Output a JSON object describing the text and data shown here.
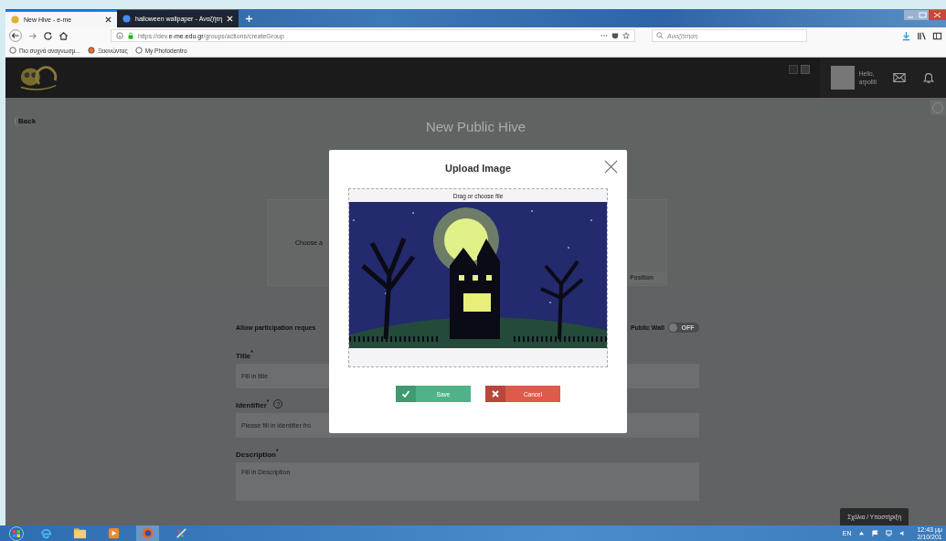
{
  "browser": {
    "tabs": [
      {
        "title": "New Hive - e-me",
        "selected": true
      },
      {
        "title": "halloween wallpaper - Αναζήτη",
        "selected": false
      }
    ],
    "url": "https://dev.**e-me.edu.gr**/groups/actions/createGroup",
    "search_placeholder": "Αναζήτηση",
    "bookmarks": [
      "Πιο συχνά αναγνωσμ...",
      "Ξεκινώντας",
      "My Photodentro"
    ]
  },
  "header": {
    "greeting": "Hello,",
    "username": "arpoliti"
  },
  "page": {
    "back": "Back",
    "title": "New Public Hive",
    "image_prompt": "Choose a",
    "position_button": "Position",
    "participation_label": "Allow participation reques",
    "public_wall": {
      "label": "Public Wall",
      "on": false,
      "state_text": "OFF"
    },
    "fields": [
      {
        "label": "Title$^{*}$",
        "placeholder": "Fill in title",
        "kind": "input"
      },
      {
        "label": "Identifier$^{*}$",
        "help": "?",
        "placeholder": "Please fill in identifier fro",
        "kind": "input"
      },
      {
        "label": "Description$^{*}$",
        "placeholder": "Fill in Description",
        "kind": "textarea"
      }
    ],
    "feedback": "Σχόλια / Υποστήριξη"
  },
  "modal": {
    "title": "Upload Image",
    "drop_hint": "Drag or choose file",
    "buttons": [
      {
        "label": "Save",
        "kind": "save"
      },
      {
        "label": "Cancel",
        "kind": "cancel"
      }
    ]
  },
  "taskbar": {
    "language": "EN",
    "time": "12:43 μμ",
    "date": "2/10/201"
  }
}
